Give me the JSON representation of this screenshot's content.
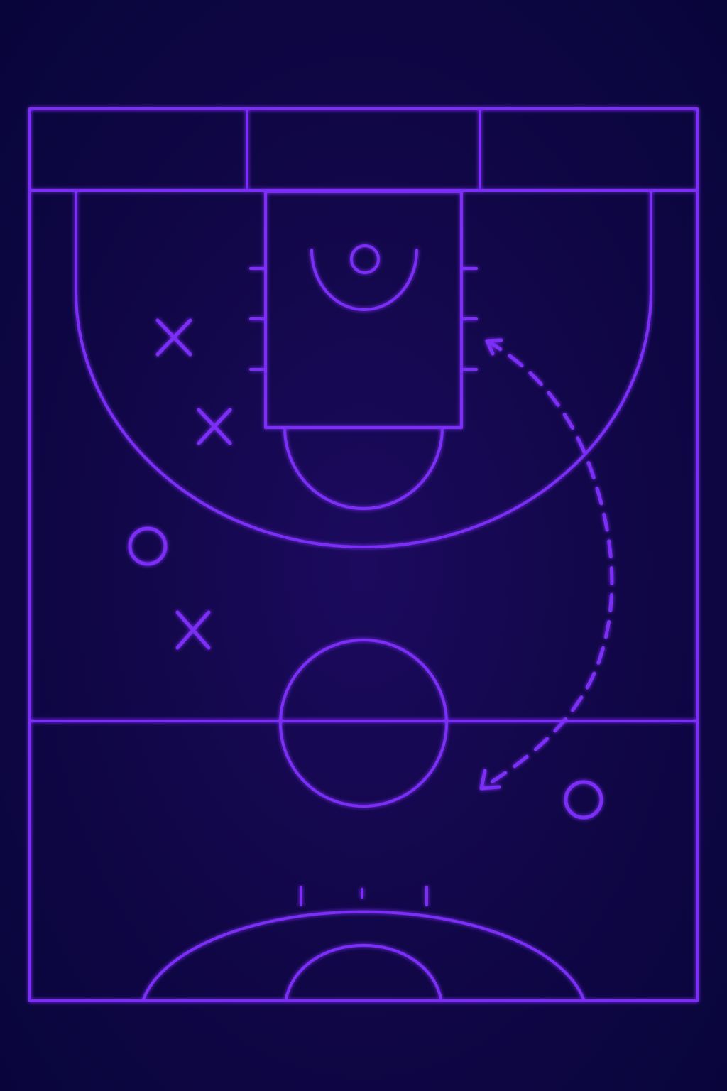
{
  "colors": {
    "background": "#0a0638",
    "line": "#7b2ff7",
    "glow": "#9a5cff"
  },
  "markers": {
    "offense_symbol": "X",
    "defense_symbol": "O",
    "offense_count": 3,
    "defense_count": 2
  },
  "play": {
    "path_style": "dashed",
    "arrow_heads": 2
  },
  "icons": {
    "offense": "x-marker-icon",
    "defense": "circle-marker-icon",
    "arrow": "dashed-arrow-icon"
  }
}
